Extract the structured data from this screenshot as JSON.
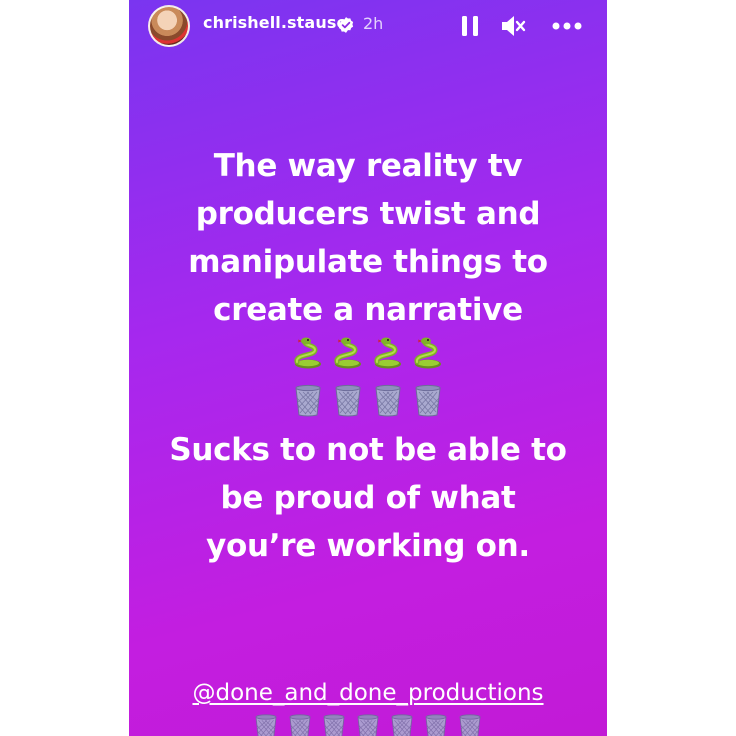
{
  "story": {
    "username": "chrishell.stause",
    "time_ago": "2h",
    "verified_icon": "verified-badge-icon",
    "controls": {
      "pause_icon": "pause-icon",
      "mute_icon": "muted-speaker-icon",
      "more_icon": "more-options-icon"
    },
    "text_lines_1": [
      "The way reality tv",
      "producers twist and",
      "manipulate things to",
      "create a narrative"
    ],
    "snake_emoji_icon": "snake-emoji-icon",
    "snake_count": 4,
    "wastebasket_emoji_icon": "wastebasket-emoji-icon",
    "wastebasket_count": 4,
    "text_lines_2": [
      "Sucks to not be able to",
      "be proud of what",
      "you’re working on."
    ],
    "mention": "@done_and_done_productions",
    "bottom_wastebasket_count": 7
  },
  "colors": {
    "gradient_top": "#7a35f0",
    "gradient_bottom": "#c21ad6",
    "text": "#ffffff"
  }
}
